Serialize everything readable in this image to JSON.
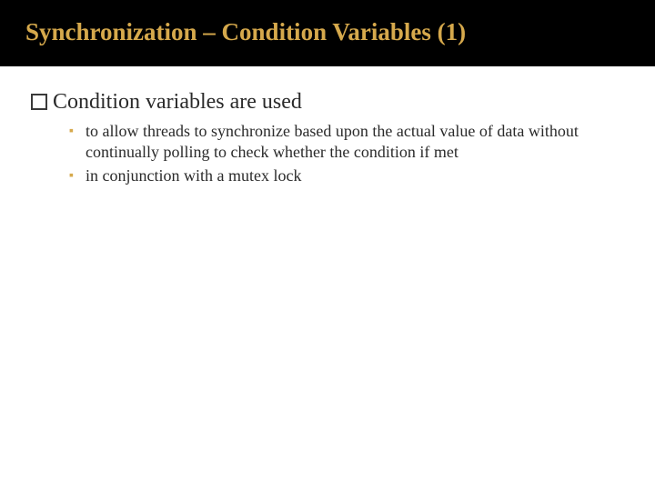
{
  "title": "Synchronization – Condition Variables (1)",
  "body": {
    "heading": "Condition variables are used",
    "bullets": {
      "b1": "to allow threads to synchronize based upon the actual value of data without continually polling to check whether the condition if met",
      "b2": "in conjunction with a mutex lock"
    }
  }
}
